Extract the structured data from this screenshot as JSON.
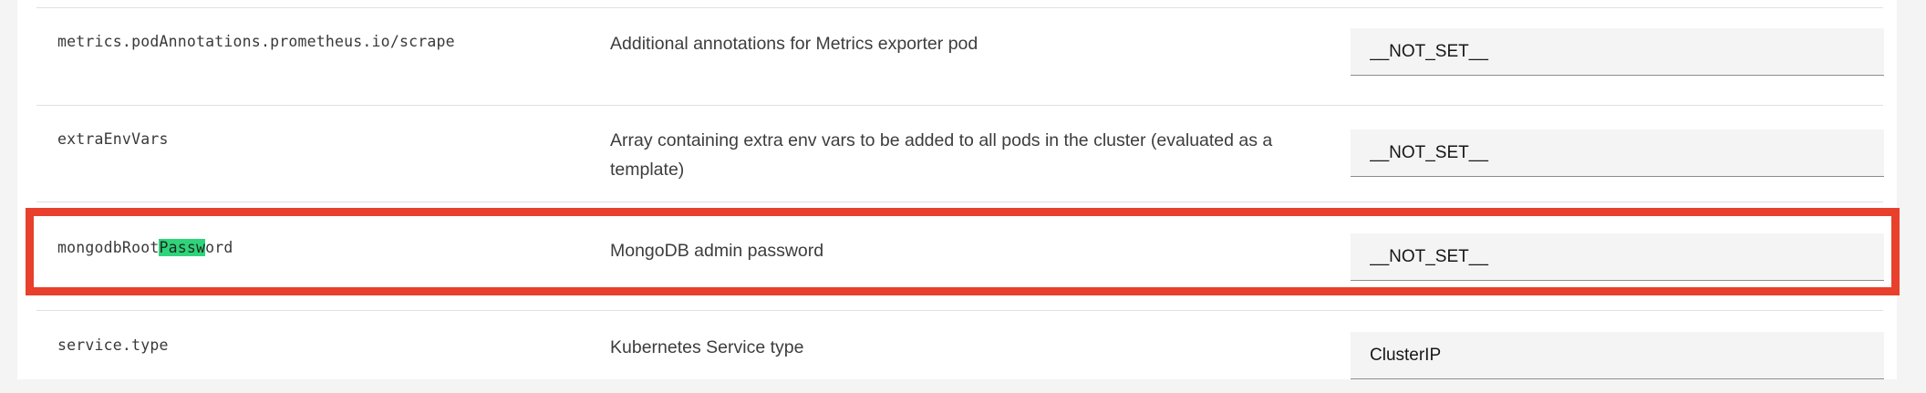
{
  "rows": [
    {
      "param_name": "metrics.podAnnotations.prometheus.io/scrape",
      "description": "Additional annotations for Metrics exporter pod",
      "value": "__NOT_SET__"
    },
    {
      "param_name": "extraEnvVars",
      "description": "Array containing extra env vars to be added to all pods in the cluster (evaluated as a template)",
      "value": "__NOT_SET__"
    },
    {
      "param_name_before": "mongodbRoot",
      "param_name_match": "Passw",
      "param_name_after": "ord",
      "description": "MongoDB admin password",
      "value": "__NOT_SET__"
    },
    {
      "param_name": "service.type",
      "description": "Kubernetes Service type",
      "value": "ClusterIP"
    }
  ],
  "colors": {
    "search_highlight": "#2fd47a",
    "annotation_box": "#e8402c"
  }
}
